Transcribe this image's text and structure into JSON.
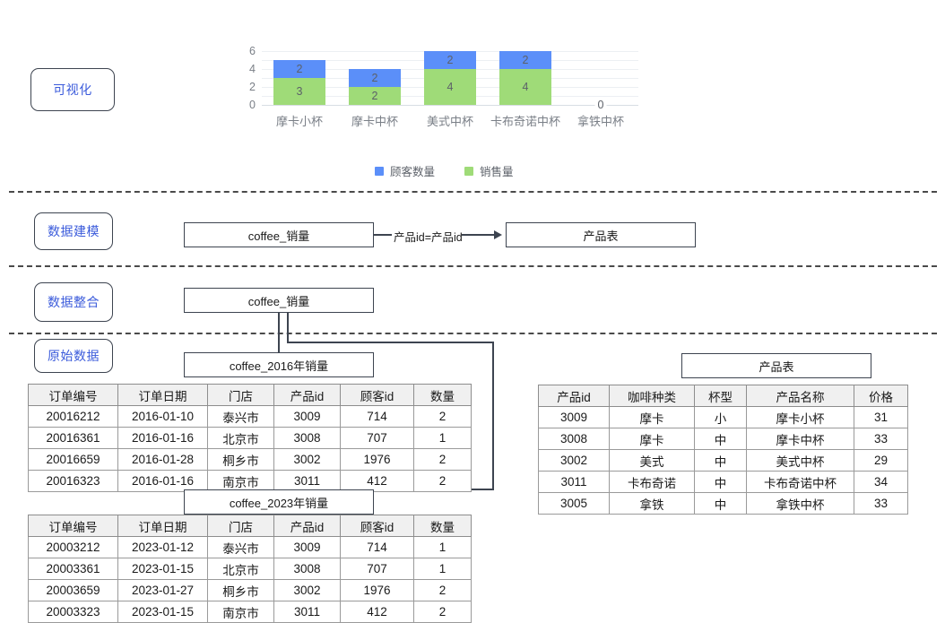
{
  "stages": [
    {
      "id": "visualization",
      "label": "可视化"
    },
    {
      "id": "modeling",
      "label": "数据建模"
    },
    {
      "id": "integration",
      "label": "数据整合"
    },
    {
      "id": "raw",
      "label": "原始数据"
    }
  ],
  "chart_data": {
    "type": "bar",
    "stacked": true,
    "title": "",
    "xlabel": "",
    "ylabel": "",
    "ylim": [
      0,
      6
    ],
    "yticks": [
      0,
      2,
      4,
      6
    ],
    "gridlines": [
      0,
      1,
      2,
      3,
      4,
      5,
      6
    ],
    "grid": true,
    "legend_position": "bottom",
    "categories": [
      "摩卡小杯",
      "摩卡中杯",
      "美式中杯",
      "卡布奇诺中杯",
      "拿铁中杯"
    ],
    "series": [
      {
        "name": "销售量",
        "color": "#9fdb78",
        "values": [
          3,
          2,
          4,
          4,
          0
        ]
      },
      {
        "name": "顾客数量",
        "color": "#5b8ff9",
        "values": [
          2,
          2,
          2,
          2,
          0
        ]
      }
    ],
    "zero_labels": [
      {
        "category": "拿铁中杯",
        "text": "0"
      }
    ]
  },
  "modeling": {
    "left_node": "coffee_销量",
    "relation_label": "产品id=产品id",
    "right_node": "产品表"
  },
  "integration": {
    "node": "coffee_销量"
  },
  "raw": {
    "tables": [
      {
        "id": "coffee-2016",
        "title": "coffee_2016年销量",
        "columns": [
          "订单编号",
          "订单日期",
          "门店",
          "产品id",
          "顾客id",
          "数量"
        ],
        "rows": [
          [
            "20016212",
            "2016-01-10",
            "泰兴市",
            "3009",
            "714",
            "2"
          ],
          [
            "20016361",
            "2016-01-16",
            "北京市",
            "3008",
            "707",
            "1"
          ],
          [
            "20016659",
            "2016-01-28",
            "桐乡市",
            "3002",
            "1976",
            "2"
          ],
          [
            "20016323",
            "2016-01-16",
            "南京市",
            "3011",
            "412",
            "2"
          ]
        ]
      },
      {
        "id": "coffee-2023",
        "title": "coffee_2023年销量",
        "columns": [
          "订单编号",
          "订单日期",
          "门店",
          "产品id",
          "顾客id",
          "数量"
        ],
        "rows": [
          [
            "20003212",
            "2023-01-12",
            "泰兴市",
            "3009",
            "714",
            "1"
          ],
          [
            "20003361",
            "2023-01-15",
            "北京市",
            "3008",
            "707",
            "1"
          ],
          [
            "20003659",
            "2023-01-27",
            "桐乡市",
            "3002",
            "1976",
            "2"
          ],
          [
            "20003323",
            "2023-01-15",
            "南京市",
            "3011",
            "412",
            "2"
          ]
        ]
      },
      {
        "id": "product",
        "title": "产品表",
        "columns": [
          "产品id",
          "咖啡种类",
          "杯型",
          "产品名称",
          "价格"
        ],
        "rows": [
          [
            "3009",
            "摩卡",
            "小",
            "摩卡小杯",
            "31"
          ],
          [
            "3008",
            "摩卡",
            "中",
            "摩卡中杯",
            "33"
          ],
          [
            "3002",
            "美式",
            "中",
            "美式中杯",
            "29"
          ],
          [
            "3011",
            "卡布奇诺",
            "中",
            "卡布奇诺中杯",
            "34"
          ],
          [
            "3005",
            "拿铁",
            "中",
            "拿铁中杯",
            "33"
          ]
        ]
      }
    ]
  }
}
